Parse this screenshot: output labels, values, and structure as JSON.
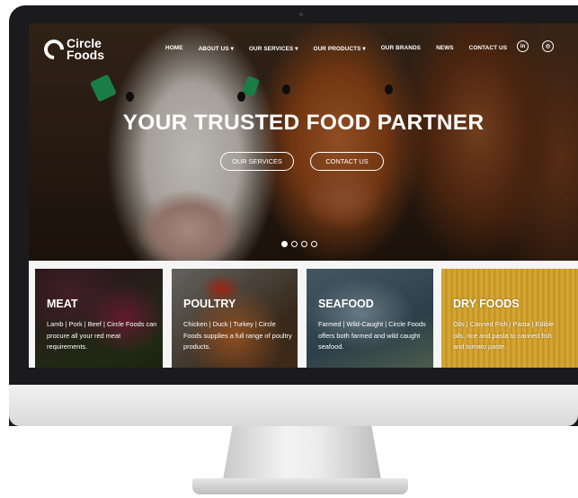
{
  "brand": {
    "line1": "Circle",
    "line2": "Foods"
  },
  "nav": {
    "items": [
      "HOME",
      "ABOUT US ▾",
      "OUR SERVICES ▾",
      "OUR PRODUCTS ▾",
      "OUR BRANDS",
      "NEWS",
      "CONTACT US"
    ],
    "social": [
      "in",
      "◎"
    ]
  },
  "hero": {
    "title": "YOUR TRUSTED FOOD PARTNER",
    "buttons": [
      "OUR SERVICES",
      "CONTACT US"
    ],
    "slides": 4,
    "active_slide": 1
  },
  "categories": [
    {
      "title": "MEAT",
      "desc": "Lamb | Pork | Beef | Circle Foods can procure all your red meat requirements."
    },
    {
      "title": "POULTRY",
      "desc": "Chicken | Duck | Turkey | Circle Foods supplies a full range of poultry products."
    },
    {
      "title": "SEAFOOD",
      "desc": "Farmed | Wild-Caught | Circle Foods offers both farmed and wild caught seafood."
    },
    {
      "title": "DRY FOODS",
      "desc": "Oils | Canned Fish | Pasta | Edible oils, rice and pasta to canned fish and tomato paste."
    }
  ],
  "colors": {
    "tag_green": "#1f9a55",
    "bezel": "#1b1b1d",
    "stand": "#d9d9d9"
  }
}
